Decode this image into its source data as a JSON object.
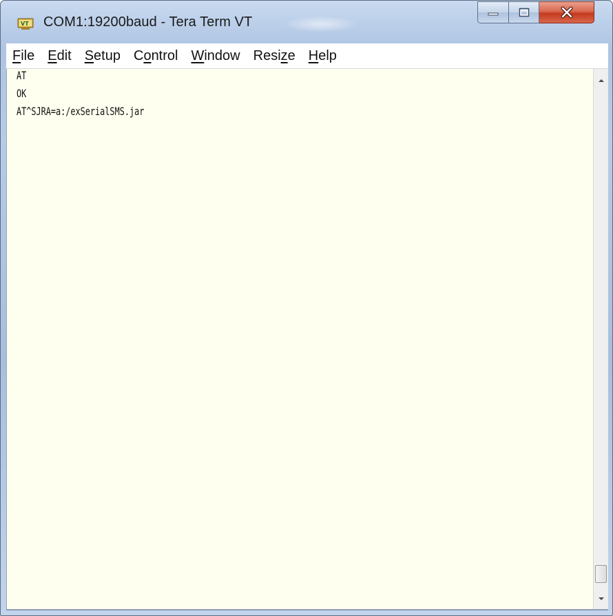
{
  "window": {
    "title": "COM1:19200baud - Tera Term VT",
    "app_icon": "teraterm-icon",
    "controls": {
      "minimize": "minimize-icon",
      "maximize": "maximize-icon",
      "close": "close-icon"
    }
  },
  "menu": {
    "items": [
      {
        "label_accel": "F",
        "label_rest": "ile"
      },
      {
        "label_accel": "E",
        "label_rest": "dit"
      },
      {
        "label_accel": "S",
        "label_rest": "etup"
      },
      {
        "label_pre": "C",
        "label_accel": "o",
        "label_rest": "ntrol"
      },
      {
        "label_accel": "W",
        "label_rest": "indow"
      },
      {
        "label_pre": "Resi",
        "label_accel": "z",
        "label_rest": "e"
      },
      {
        "label_accel": "H",
        "label_rest": "elp"
      }
    ]
  },
  "terminal": {
    "lines": [
      "AT",
      "OK",
      "AT^SJRA=a:/exSerialSMS.jar"
    ]
  },
  "scrollbar": {
    "up_icon": "scroll-up-icon",
    "down_icon": "scroll-down-icon"
  }
}
